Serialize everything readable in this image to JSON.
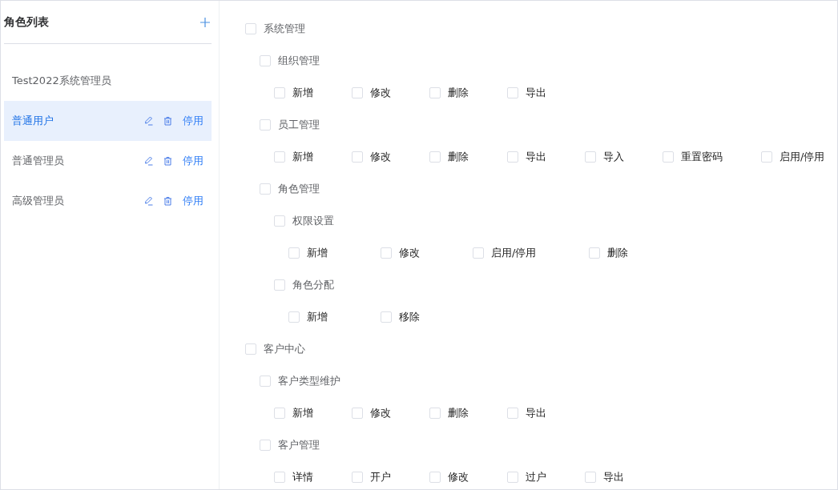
{
  "sidebar": {
    "title": "角色列表",
    "items": [
      {
        "label": "Test2022系统管理员",
        "selected": false
      },
      {
        "label": "普通用户",
        "selected": true,
        "disable_label": "停用"
      },
      {
        "label": "普通管理员",
        "selected": false,
        "disable_label": "停用"
      },
      {
        "label": "高级管理员",
        "selected": false,
        "disable_label": "停用"
      }
    ]
  },
  "tree": [
    {
      "label": "系统管理",
      "checked": false,
      "children": [
        {
          "label": "组织管理",
          "checked": false,
          "children": [
            {
              "label": "新增",
              "checked": false
            },
            {
              "label": "修改",
              "checked": false
            },
            {
              "label": "删除",
              "checked": false
            },
            {
              "label": "导出",
              "checked": false
            }
          ]
        },
        {
          "label": "员工管理",
          "checked": false,
          "children": [
            {
              "label": "新增",
              "checked": false
            },
            {
              "label": "修改",
              "checked": false
            },
            {
              "label": "删除",
              "checked": false
            },
            {
              "label": "导出",
              "checked": false
            },
            {
              "label": "导入",
              "checked": false
            },
            {
              "label": "重置密码",
              "checked": false
            },
            {
              "label": "启用/停用",
              "checked": false
            }
          ]
        },
        {
          "label": "角色管理",
          "checked": false,
          "children": [
            {
              "label": "权限设置",
              "checked": false,
              "children": [
                {
                  "label": "新增",
                  "checked": false
                },
                {
                  "label": "修改",
                  "checked": false
                },
                {
                  "label": "启用/停用",
                  "checked": false
                },
                {
                  "label": "删除",
                  "checked": false
                }
              ]
            },
            {
              "label": "角色分配",
              "checked": false,
              "children": [
                {
                  "label": "新增",
                  "checked": false
                },
                {
                  "label": "移除",
                  "checked": false
                }
              ]
            }
          ]
        }
      ]
    },
    {
      "label": "客户中心",
      "checked": false,
      "children": [
        {
          "label": "客户类型维护",
          "checked": false,
          "children": [
            {
              "label": "新增",
              "checked": false
            },
            {
              "label": "修改",
              "checked": false
            },
            {
              "label": "删除",
              "checked": false
            },
            {
              "label": "导出",
              "checked": false
            }
          ]
        },
        {
          "label": "客户管理",
          "checked": false,
          "children": [
            {
              "label": "详情",
              "checked": false
            },
            {
              "label": "开户",
              "checked": false
            },
            {
              "label": "修改",
              "checked": false
            },
            {
              "label": "过户",
              "checked": false
            },
            {
              "label": "导出",
              "checked": false
            }
          ]
        }
      ]
    }
  ]
}
